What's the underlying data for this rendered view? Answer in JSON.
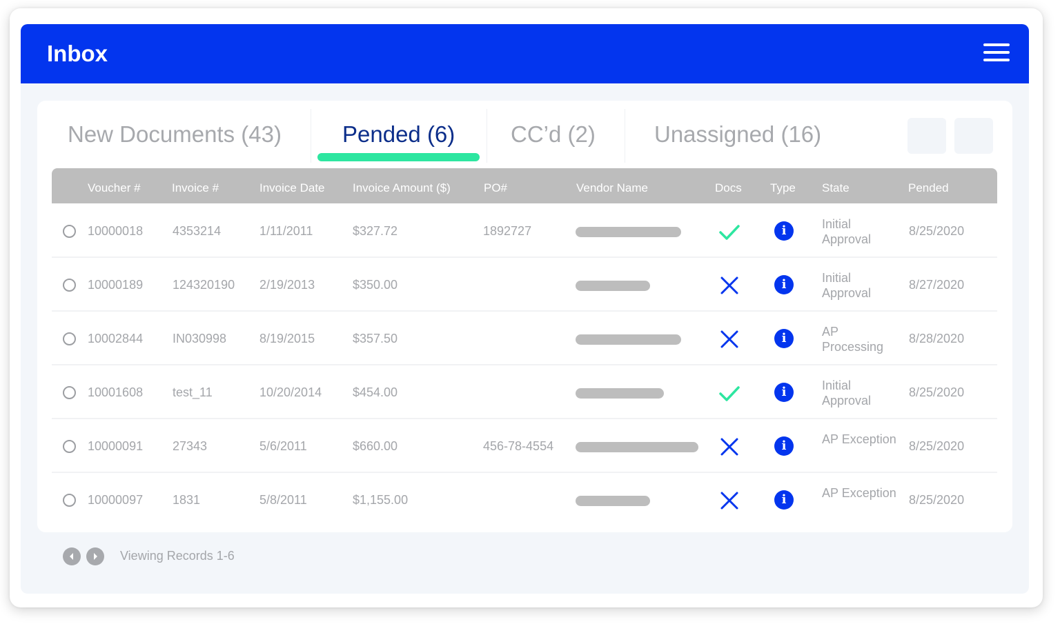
{
  "header": {
    "title": "Inbox",
    "menu_icon": "hamburger-menu-icon"
  },
  "tabs": [
    {
      "label": "New Documents (43)",
      "active": false
    },
    {
      "label": "Pended (6)",
      "active": true
    },
    {
      "label": "CC’d (2)",
      "active": false
    },
    {
      "label": "Unassigned (16)",
      "active": false
    }
  ],
  "table": {
    "columns": [
      "Voucher #",
      "Invoice #",
      "Invoice Date",
      "Invoice Amount ($)",
      "PO#",
      "Vendor Name",
      "Docs",
      "Type",
      "State",
      "Pended"
    ],
    "rows": [
      {
        "voucher": "10000018",
        "invoice": "4353214",
        "date": "1/11/2011",
        "amount": "$327.72",
        "po": "1892727",
        "docs": "check",
        "state": "Initial Approval",
        "pended": "8/25/2020"
      },
      {
        "voucher": "10000189",
        "invoice": "124320190",
        "date": "2/19/2013",
        "amount": "$350.00",
        "po": "",
        "docs": "x",
        "state": "Initial Approval",
        "pended": "8/27/2020"
      },
      {
        "voucher": "10002844",
        "invoice": "IN030998",
        "date": "8/19/2015",
        "amount": "$357.50",
        "po": "",
        "docs": "x",
        "state": "AP Processing",
        "pended": "8/28/2020"
      },
      {
        "voucher": "10001608",
        "invoice": "test_11",
        "date": "10/20/2014",
        "amount": "$454.00",
        "po": "",
        "docs": "check",
        "state": "Initial Approval",
        "pended": "8/25/2020"
      },
      {
        "voucher": "10000091",
        "invoice": "27343",
        "date": "5/6/2011",
        "amount": "$660.00",
        "po": "456-78-4554",
        "docs": "x",
        "state": "AP Exception",
        "pended": "8/25/2020"
      },
      {
        "voucher": "10000097",
        "invoice": "1831",
        "date": "5/8/2011",
        "amount": "$1,155.00",
        "po": "",
        "docs": "x",
        "state": "AP Exception",
        "pended": "8/25/2020"
      }
    ]
  },
  "footer": {
    "viewing": "Viewing Records 1-6"
  },
  "colors": {
    "brand_blue": "#0335ee",
    "active_tab_text": "#0c2e8a",
    "active_underline": "#2de6a0",
    "check_green": "#2de6a0",
    "x_blue": "#0335ee"
  }
}
